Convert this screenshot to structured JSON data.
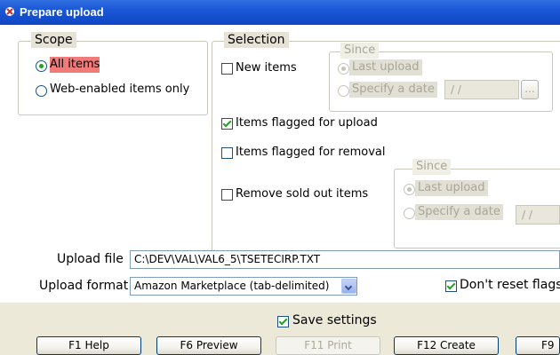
{
  "window": {
    "title": "Prepare upload"
  },
  "scope": {
    "legend": "Scope",
    "options": [
      {
        "label": "All items",
        "selected": true
      },
      {
        "label": "Web-enabled items only",
        "selected": false
      }
    ]
  },
  "selection": {
    "legend": "Selection",
    "new_items": {
      "label": "New items",
      "checked": false
    },
    "flagged_upload": {
      "label": "Items flagged for upload",
      "checked": true
    },
    "flagged_removal": {
      "label": "Items flagged for removal",
      "checked": false
    },
    "remove_sold": {
      "label": "Remove sold out items",
      "checked": false
    },
    "since_new": {
      "legend": "Since",
      "last_upload": "Last upload",
      "specify_date": "Specify a date",
      "date_value": "/ /",
      "browse_label": "..."
    },
    "since_sold": {
      "legend": "Since",
      "last_upload": "Last upload",
      "specify_date": "Specify a date",
      "date_value": "/ /"
    }
  },
  "upload": {
    "file_label": "Upload file",
    "file_value": "C:\\DEV\\VAL\\VAL6_5\\TSETECIRP.TXT",
    "format_label": "Upload format",
    "format_value": "Amazon Marketplace (tab-delimited)",
    "dont_reset_label": "Don't reset flags",
    "dont_reset_checked": true
  },
  "footer": {
    "save_settings_label": "Save settings",
    "save_settings_checked": true,
    "buttons": [
      "F1 Help",
      "F6 Preview",
      "F11 Print",
      "F12 Create",
      "F9"
    ]
  },
  "colors": {
    "title_bar": "#1a56d6",
    "highlight": "#ef7b7b",
    "face": "#ece9d8"
  }
}
